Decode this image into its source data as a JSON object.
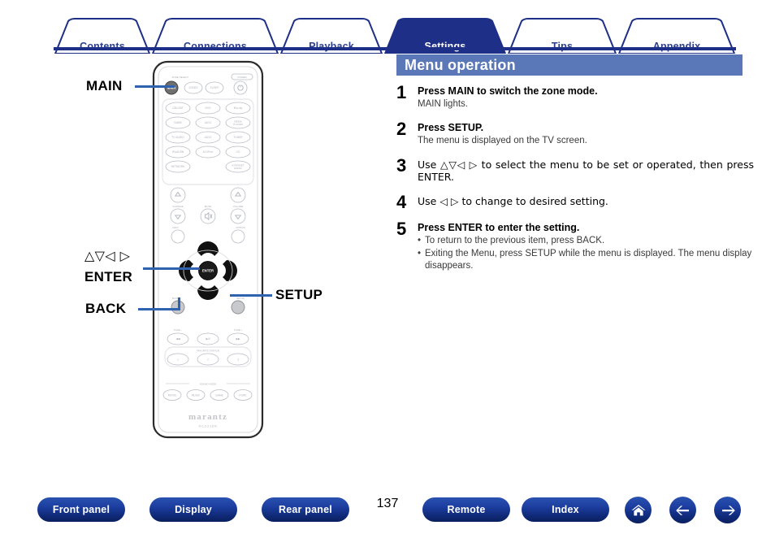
{
  "tabs": [
    {
      "label": "Contents",
      "active": false
    },
    {
      "label": "Connections",
      "active": false
    },
    {
      "label": "Playback",
      "active": false
    },
    {
      "label": "Settings",
      "active": true
    },
    {
      "label": "Tips",
      "active": false
    },
    {
      "label": "Appendix",
      "active": false
    }
  ],
  "section": {
    "title": "Menu operation"
  },
  "steps": [
    {
      "num": "1",
      "title": "Press MAIN to switch the zone mode.",
      "sub": "MAIN lights.",
      "bullets": []
    },
    {
      "num": "2",
      "title": "Press SETUP.",
      "sub": "The menu is displayed on the TV screen.",
      "bullets": []
    },
    {
      "num": "3",
      "title": "Use △▽◁ ▷ to select the menu to be set or operated, then press ENTER.",
      "sub": "",
      "bullets": []
    },
    {
      "num": "4",
      "title": "Use ◁ ▷ to change to desired setting.",
      "sub": "",
      "bullets": []
    },
    {
      "num": "5",
      "title": "Press ENTER to enter the setting.",
      "sub": "",
      "bullets": [
        "To return to the previous item, press BACK.",
        "Exiting the Menu, press SETUP while the menu is displayed. The menu display disappears."
      ]
    }
  ],
  "callouts": {
    "main": "MAIN",
    "cursor": "△▽◁ ▷",
    "enter": "ENTER",
    "back": "BACK",
    "setup": "SETUP"
  },
  "remote": {
    "brand": "marantz",
    "model": "RC0218R",
    "zone_select_label": "ZONE SELECT",
    "power_label": "POWER",
    "zone_buttons": [
      "MAIN",
      "ZONE2",
      "SLEEP"
    ],
    "source_rows": [
      [
        "CBL/SAT",
        "DVD",
        "Blu-ray"
      ],
      [
        "GAME",
        "AUX1",
        "MEDIA PLAYER"
      ],
      [
        "TV AUDIO",
        "AUX2",
        "TUNER"
      ],
      [
        "iPod/USB",
        "M-XPort",
        "CD"
      ],
      [
        "NETWORK",
        "",
        "INTERNET RADIO"
      ]
    ],
    "mid_labels": {
      "channel": "CH/PAGE",
      "mute": "MUTE",
      "volume": "VOLUME",
      "info": "INFO",
      "option": "OPTION"
    },
    "dpad_center": "ENTER",
    "back_label": "BACK",
    "setup_label": "SETUP",
    "tune_minus": "TUNE –",
    "tune_plus": "TUNE +",
    "transport": [
      "◀◀",
      "▶/Ⅱ",
      "▶▶"
    ],
    "favorite_label": "FAVORITE STATION",
    "favorites": [
      "1",
      "2",
      "3"
    ],
    "sound_mode_label": "SOUND MODE",
    "sound_modes": [
      "MOVIE",
      "MUSIC",
      "GAME",
      "PURE"
    ]
  },
  "footer": {
    "buttons": [
      {
        "label": "Front panel"
      },
      {
        "label": "Display"
      },
      {
        "label": "Rear panel"
      }
    ],
    "buttons_right": [
      {
        "label": "Remote"
      },
      {
        "label": "Index"
      }
    ],
    "icons": [
      "home-icon",
      "arrow-left-icon",
      "arrow-right-icon"
    ],
    "page_number": "137"
  },
  "colors": {
    "tab_blue": "#2b3f8c",
    "tab_active_fill": "#1d2f86",
    "section_header": "#5a77b8",
    "leader_line": "#2f63b0",
    "pill_top": "#2a52b0",
    "pill_bottom": "#0a1f5e"
  }
}
